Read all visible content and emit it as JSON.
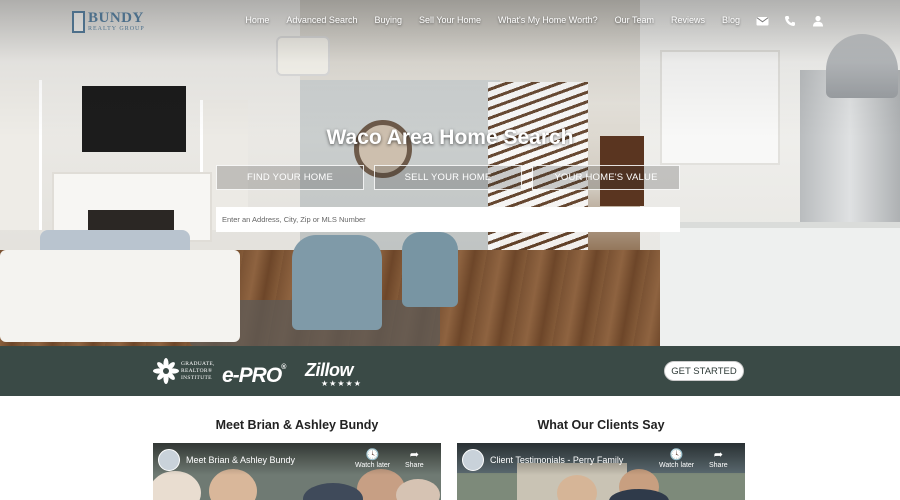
{
  "brand": {
    "name": "BUNDY",
    "subtitle": "REALTY GROUP"
  },
  "nav": {
    "items": [
      "Home",
      "Advanced Search",
      "Buying",
      "Sell Your Home",
      "What's My Home Worth?",
      "Our Team",
      "Reviews",
      "Blog"
    ],
    "icons": [
      "envelope-icon",
      "phone-icon",
      "user-icon"
    ]
  },
  "hero": {
    "title": "Waco Area Home Search",
    "tabs": [
      "FIND YOUR HOME",
      "SELL YOUR HOME",
      "YOUR HOME'S VALUE"
    ],
    "search_placeholder": "Enter an Address, City, Zip or MLS Number"
  },
  "badges": {
    "gri": [
      "GRADUATE,",
      "REALTOR®",
      "INSTITUTE"
    ],
    "epro": "e-PRO",
    "zillow": "Zillow",
    "zillow_stars": "★★★★★",
    "cta": "GET STARTED"
  },
  "sections": {
    "left_title": "Meet Brian & Ashley Bundy",
    "right_title": "What Our Clients Say"
  },
  "videos": [
    {
      "title": "Meet Brian & Ashley Bundy",
      "watch_later": "Watch later",
      "share": "Share"
    },
    {
      "title": "Client Testimonials - Perry Family",
      "watch_later": "Watch later",
      "share": "Share"
    }
  ],
  "colors": {
    "brand": "#4d6f8a",
    "badge_bar": "#3a4a46"
  }
}
